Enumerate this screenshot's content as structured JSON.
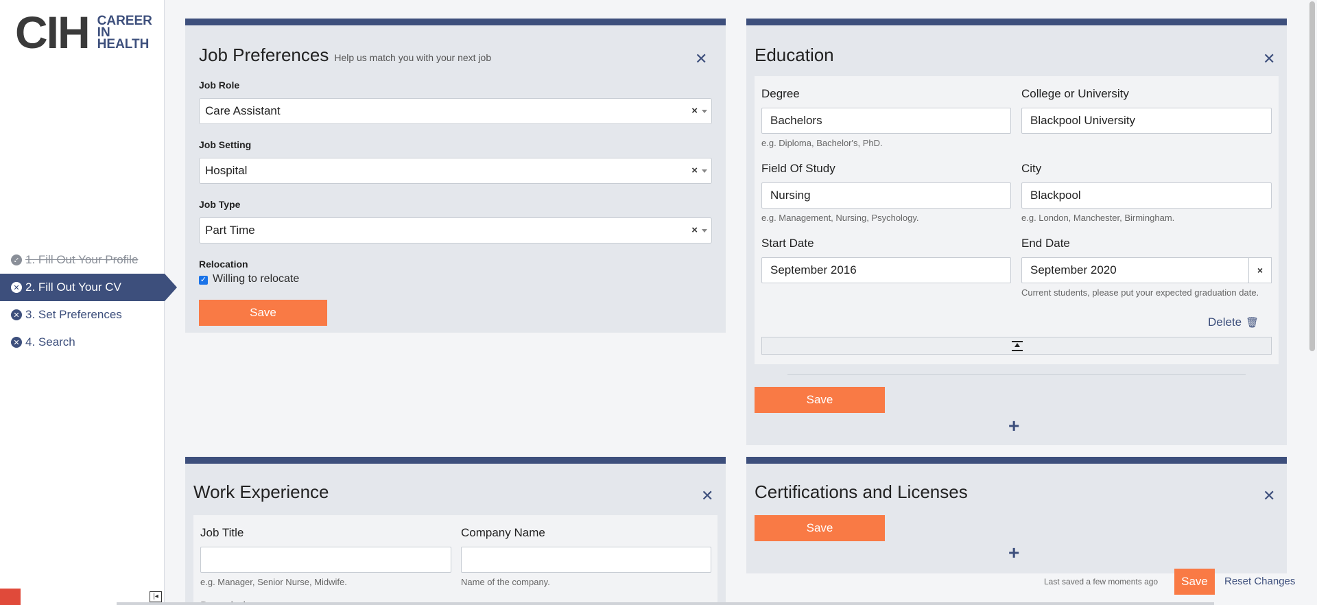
{
  "brand": {
    "mark": "CIH",
    "line1": "CAREER",
    "line2": "IN",
    "line3": "HEALTH"
  },
  "steps": [
    {
      "label": "1. Fill Out Your Profile",
      "state": "done"
    },
    {
      "label": "2. Fill Out Your CV",
      "state": "active"
    },
    {
      "label": "3. Set Preferences",
      "state": "todo"
    },
    {
      "label": "4. Search",
      "state": "todo"
    }
  ],
  "job_preferences": {
    "title": "Job Preferences",
    "subtitle": "Help us match you with your next job",
    "job_role_label": "Job Role",
    "job_role_value": "Care Assistant",
    "job_setting_label": "Job Setting",
    "job_setting_value": "Hospital",
    "job_type_label": "Job Type",
    "job_type_value": "Part Time",
    "relocation_label": "Relocation",
    "relocation_option": "Willing to relocate",
    "relocation_checked": true,
    "save_label": "Save"
  },
  "education": {
    "title": "Education",
    "degree_label": "Degree",
    "degree_value": "Bachelors",
    "degree_hint": "e.g. Diploma, Bachelor's, PhD.",
    "college_label": "College or University",
    "college_value": "Blackpool University",
    "field_label": "Field Of Study",
    "field_value": "Nursing",
    "field_hint": "e.g. Management, Nursing, Psychology.",
    "city_label": "City",
    "city_value": "Blackpool",
    "city_hint": "e.g. London, Manchester, Birmingham.",
    "start_label": "Start Date",
    "start_value": "September 2016",
    "end_label": "End Date",
    "end_value": "September 2020",
    "end_hint": "Current students, please put your expected graduation date.",
    "delete_label": "Delete",
    "save_label": "Save"
  },
  "work_experience": {
    "title": "Work Experience",
    "job_title_label": "Job Title",
    "job_title_value": "",
    "job_title_hint": "e.g. Manager, Senior Nurse, Midwife.",
    "company_label": "Company Name",
    "company_value": "",
    "company_hint": "Name of the company.",
    "description_label": "Description"
  },
  "certifications": {
    "title": "Certifications and Licenses",
    "save_label": "Save"
  },
  "footer": {
    "last_saved": "Last saved a few moments ago",
    "save_label": "Save",
    "reset_label": "Reset Changes"
  },
  "icons": [
    "check-circle-icon",
    "x-circle-icon",
    "close-icon",
    "trash-icon",
    "collapse-icon",
    "plus-icon",
    "sidebar-toggle-icon"
  ],
  "colors": {
    "accent": "#f97a45",
    "brand": "#3d4f7c",
    "card": "#e4e7ec"
  }
}
